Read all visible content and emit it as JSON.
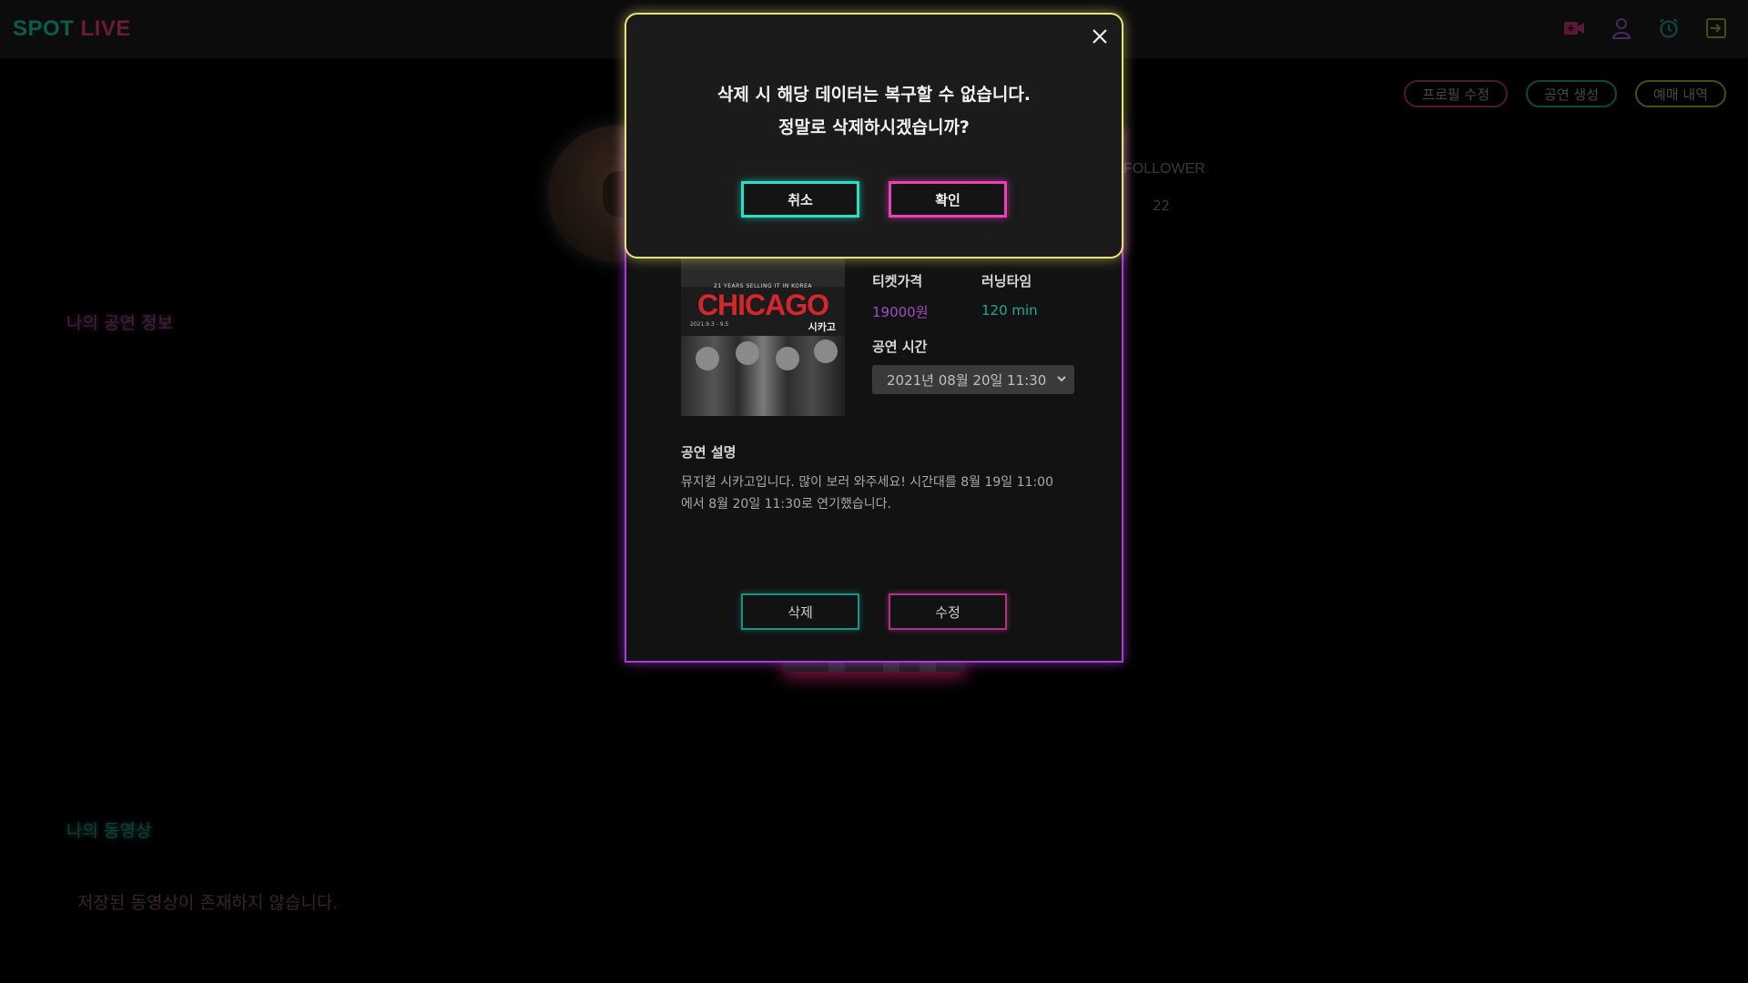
{
  "app": {
    "logo_spot": "SPOT",
    "logo_live": "LIVE"
  },
  "nav": {
    "icons": [
      "video-add-icon",
      "user-icon",
      "alarm-clock-icon",
      "logout-icon"
    ]
  },
  "profile_actions": {
    "edit_profile": "프로필 수정",
    "create_show": "공연 생성",
    "reservations": "예매 내역"
  },
  "profile": {
    "follower_label": "FOLLOWER",
    "follower_count": "22"
  },
  "sections": {
    "my_shows": "나의 공연 정보",
    "my_videos": "나의 동영상",
    "no_videos": "저장된 동영상이 존재하지 않습니다."
  },
  "detail": {
    "poster": {
      "title": "CHICAGO",
      "tagline": "21 YEARS SELLING IT IN KOREA",
      "dates": "2021.9.3 - 9.5",
      "korean_title": "시카고"
    },
    "ticket_price_label": "티켓가격",
    "ticket_price": "19000원",
    "running_time_label": "러닝타임",
    "running_time": "120 min",
    "showtime_label": "공연 시간",
    "showtime_selected": "2021년 08월 20일 11:30",
    "description_label": "공연 설명",
    "description": "뮤지컬 시카고입니다. 많이 보러 와주세요! 시간대를 8월 19일 11:00에서 8월 20일 11:30로 연기했습니다.",
    "delete_label": "삭제",
    "edit_label": "수정"
  },
  "confirm": {
    "line1": "삭제 시 해당 데이터는 복구할 수 없습니다.",
    "line2": "정말로 삭제하시겠습니까?",
    "cancel_label": "취소",
    "ok_label": "확인"
  },
  "colors": {
    "teal": "#27e0c6",
    "pink": "#ee3fb6",
    "purple": "#a33fd1",
    "yellow": "#e8e27a"
  }
}
